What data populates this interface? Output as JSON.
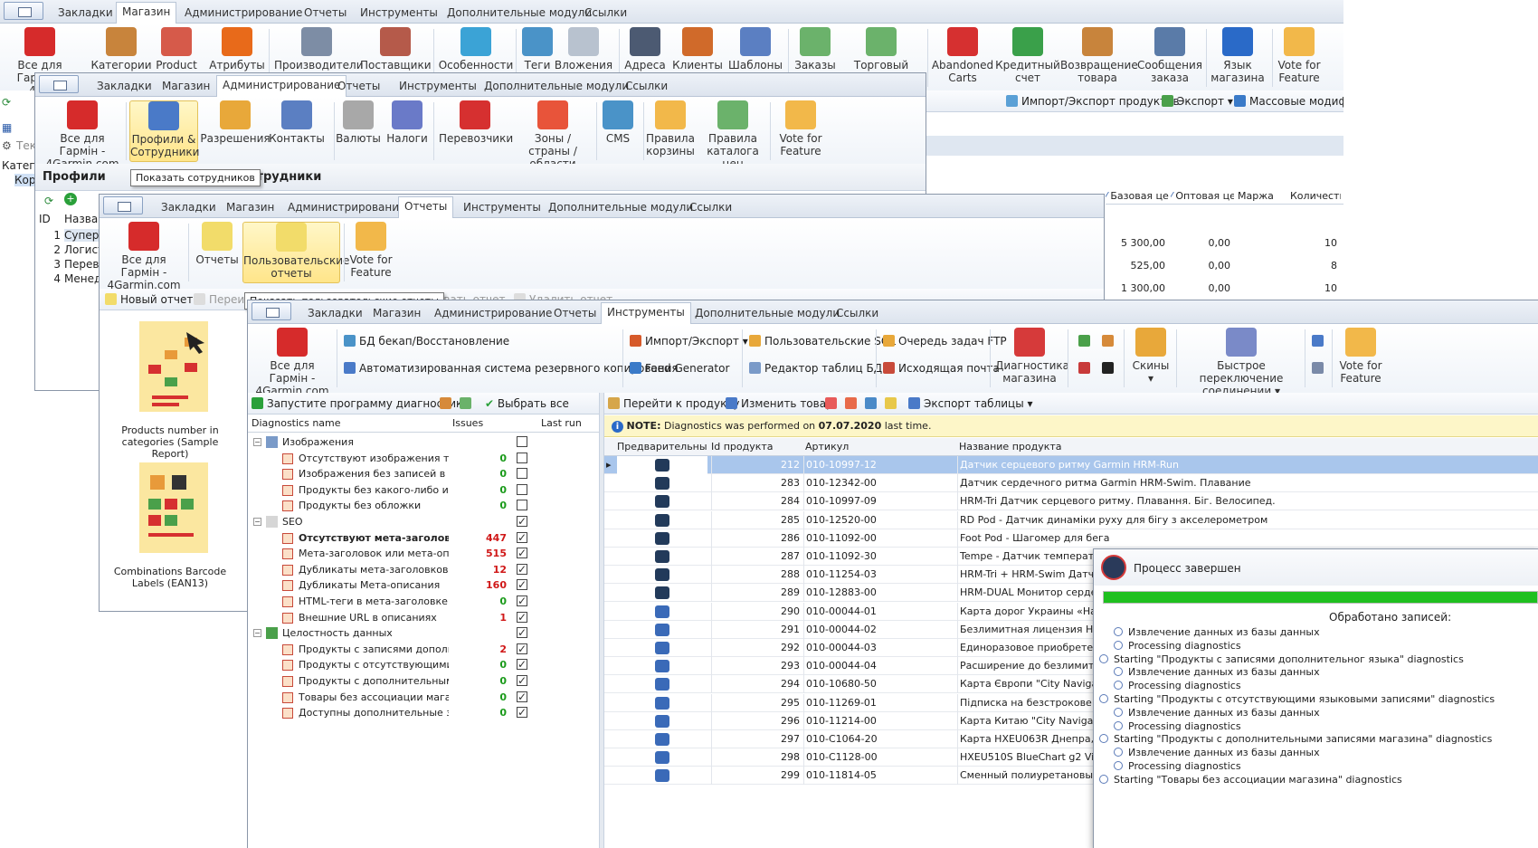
{
  "w1": {
    "tabs": [
      "Закладки",
      "Магазин",
      "Администрирование",
      "Отчеты",
      "Инструменты",
      "Дополнительные модули",
      "Ссылки"
    ],
    "active": 1,
    "buttons": [
      "Все для Гармін - 4Ga",
      "Категории",
      "Product",
      "Атрибуты",
      "Производители",
      "Поставщики",
      "Особенности",
      "Теги",
      "Вложения",
      "Адреса",
      "Клиенты",
      "Шаблоны",
      "Заказы",
      "Торговый",
      "Abandoned Carts",
      "Кредитный счет",
      "Возвращение товара",
      "Сообщения заказа",
      "Язык магазина",
      "Vote for Feature"
    ],
    "toolbar": [
      "Импорт/Экспорт продуктов",
      "Экспорт",
      "Массовые модифик"
    ],
    "left_items": [
      "Текс",
      "Категор",
      "Кор"
    ],
    "cols": [
      "Базовая це",
      "Оптовая це",
      "Маржа",
      "Количеств"
    ],
    "rows": [
      [
        "5 300,00",
        "0,00",
        "10"
      ],
      [
        "525,00",
        "0,00",
        "8"
      ],
      [
        "1 300,00",
        "0,00",
        "10"
      ]
    ]
  },
  "w2": {
    "tabs": [
      "Закладки",
      "Магазин",
      "Администрирование",
      "Отчеты",
      "Инструменты",
      "Дополнительные модули",
      "Ссылки"
    ],
    "active": 2,
    "buttons": [
      "Все для Гармін - 4Garmin.com",
      "Профили & Сотрудники",
      "Разрешения",
      "Контакты",
      "Валюты",
      "Налоги",
      "Перевозчики",
      "Зоны / страны / области",
      "CMS",
      "Правила корзины",
      "Правила каталога цен",
      "Vote for Feature"
    ],
    "title": "Профили",
    "title2": "Сотрудники",
    "tooltip": "Показать сотрудников",
    "cols": [
      "ID",
      "Назван"
    ],
    "rows": [
      [
        "1",
        "Суперад"
      ],
      [
        "2",
        "Логист"
      ],
      [
        "3",
        "Перевод"
      ],
      [
        "4",
        "Менедж"
      ]
    ]
  },
  "w3": {
    "tabs": [
      "Закладки",
      "Магазин",
      "Администрирование",
      "Отчеты",
      "Инструменты",
      "Дополнительные модули",
      "Ссылки"
    ],
    "active": 3,
    "buttons": [
      "Все для Гармін - 4Garmin.com",
      "Отчеты",
      "Пользовательские отчеты",
      "Vote for Feature"
    ],
    "new_report": "Новый отчет",
    "rename": "Переи",
    "tooltip": "Показать пользовательские отчеты",
    "edit": "актировать отчет",
    "delete": "Удалить отчет",
    "reports": [
      "Products number in categories (Sample Report)",
      "Combinations Barcode Labels (EAN13)"
    ]
  },
  "w4": {
    "tabs": [
      "Закладки",
      "Магазин",
      "Администрирование",
      "Отчеты",
      "Инструменты",
      "Дополнительные модули",
      "Ссылки"
    ],
    "active": 4,
    "home": "Все для Гармін - 4Garmin.com",
    "small": [
      "БД бекап/Восстановление",
      "Автоматизированная система резервного копирования",
      "Импорт/Экспорт",
      "Feed Generator",
      "Пользовательские SQL",
      "Редактор таблиц БД",
      "Очередь задач FTP",
      "Исходящая почта"
    ],
    "big": [
      "Диагностика магазина",
      "Скины",
      "Быстрое переключение соединении",
      "Vote for Feature"
    ],
    "diag_toolbar": [
      "Запустите программу диагностики",
      "Выбрать все"
    ],
    "diag_cols": [
      "Diagnostics name",
      "Issues",
      "Last run"
    ],
    "groups": [
      {
        "name": "Изображения",
        "items": [
          [
            "Отсутствуют изображения товара",
            "0",
            false
          ],
          [
            "Изображения без записей в базе да",
            "0",
            false
          ],
          [
            "Продукты без какого-либо изобра",
            "0",
            false
          ],
          [
            "Продукты без обложки",
            "0",
            false
          ]
        ]
      },
      {
        "name": "SEO",
        "items": [
          [
            "Отсутствуют мета-заголовки",
            "447",
            true
          ],
          [
            "Мета-заголовок или мета-описания",
            "515",
            true
          ],
          [
            "Дубликаты мета-заголовков",
            "12",
            true
          ],
          [
            "Дубликаты Мета-описания",
            "160",
            true
          ],
          [
            "HTML-теги в мета-заголовке или ме",
            "0",
            true
          ],
          [
            "Внешние URL в описаниях",
            "1",
            true
          ]
        ]
      },
      {
        "name": "Целостность данных",
        "items": [
          [
            "Продукты с записями дополнитель",
            "2",
            true
          ],
          [
            "Продукты с отсутствующими язык",
            "0",
            true
          ],
          [
            "Продукты с дополнительными запи",
            "0",
            true
          ],
          [
            "Товары без ассоциации магазина",
            "0",
            true
          ],
          [
            "Доступны дополнительные записи",
            "0",
            true
          ]
        ]
      }
    ],
    "prod_toolbar": [
      "Перейти к продукту",
      "Изменить товар",
      "Экспорт таблицы"
    ],
    "note_label": "NOTE:",
    "note_text": "Diagnostics was performed on",
    "note_date": "07.07.2020",
    "note_tail": "last time.",
    "prod_cols": [
      "Предварительный пр",
      "Id продукта",
      "Артикул",
      "Название продукта"
    ],
    "products": [
      [
        "212",
        "010-10997-12",
        "Датчик серцевого ритму Garmin HRM-Run"
      ],
      [
        "283",
        "010-12342-00",
        "Датчик сердечного ритма Garmin HRM-Swim. Плавание"
      ],
      [
        "284",
        "010-10997-09",
        "HRM-Tri Датчик серцевого ритму. Плавання. Біг. Велосипед."
      ],
      [
        "285",
        "010-12520-00",
        "RD Pod - Датчик динаміки руху для бігу з акселерометром"
      ],
      [
        "286",
        "010-11092-00",
        "Foot Pod - Шагомер для бега"
      ],
      [
        "287",
        "010-11092-30",
        "Tempe - Датчик температури"
      ],
      [
        "288",
        "010-11254-03",
        "HRM-Tri + HRM-Swim Датчики с"
      ],
      [
        "289",
        "010-12883-00",
        "HRM-DUAL Монитор сердечног"
      ],
      [
        "290",
        "010-00044-01",
        "Карта дорог Украины «НавЛюк"
      ],
      [
        "291",
        "010-00044-02",
        "Безлимитная лицензия НавЛюк"
      ],
      [
        "292",
        "010-00044-03",
        "Единоразовое приобретение ка"
      ],
      [
        "293",
        "010-00044-04",
        "Расширение до безлимитной к"
      ],
      [
        "294",
        "010-10680-50",
        "Карта Європи \"City Navigator Eu"
      ],
      [
        "295",
        "010-11269-01",
        "Підписка на безстрокове онов"
      ],
      [
        "296",
        "010-11214-00",
        "Карта Китаю \"City Navigator Ch"
      ],
      [
        "297",
        "010-C1064-20",
        "Карта HXEU063R Днепра, Дне"
      ],
      [
        "298",
        "010-C1128-00",
        "HXEU510S BlueChart g2 Vision HD"
      ],
      [
        "299",
        "010-11814-05",
        "Сменный полиуретановый реме"
      ]
    ],
    "process": {
      "title": "Процесс завершен",
      "processed": "Обработано записей:",
      "log": [
        [
          "1",
          "Извлечение данных из базы данных"
        ],
        [
          "1",
          "Processing diagnostics"
        ],
        [
          "0",
          "Starting \"Продукты с записями дополнительног языка\" diagnostics"
        ],
        [
          "1",
          "Извлечение данных из базы данных"
        ],
        [
          "1",
          "Processing diagnostics"
        ],
        [
          "0",
          "Starting \"Продукты с отсутствующими языковыми записями\" diagnostics"
        ],
        [
          "1",
          "Извлечение данных из базы данных"
        ],
        [
          "1",
          "Processing diagnostics"
        ],
        [
          "0",
          "Starting \"Продукты с дополнительными записями магазина\" diagnostics"
        ],
        [
          "1",
          "Извлечение данных из базы данных"
        ],
        [
          "1",
          "Processing diagnostics"
        ],
        [
          "0",
          "Starting \"Товары без ассоциации магазина\" diagnostics"
        ]
      ]
    }
  }
}
